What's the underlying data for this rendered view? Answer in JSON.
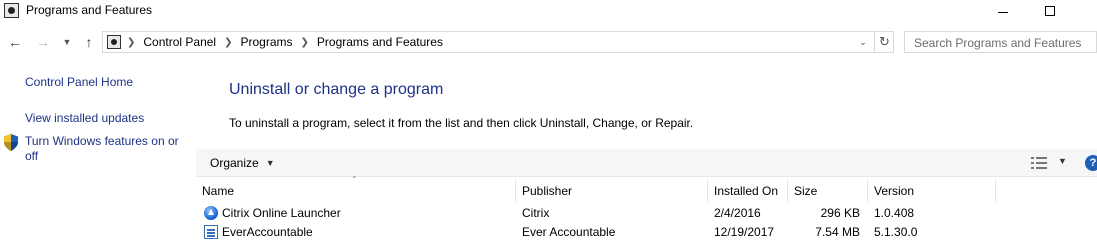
{
  "window": {
    "title": "Programs and Features"
  },
  "address": {
    "crumbs": [
      "Control Panel",
      "Programs",
      "Programs and Features"
    ],
    "search_placeholder": "Search Programs and Features"
  },
  "sidebar": {
    "home": "Control Panel Home",
    "updates": "View installed updates",
    "features": "Turn Windows features on or off"
  },
  "main": {
    "heading": "Uninstall or change a program",
    "description": "To uninstall a program, select it from the list and then click Uninstall, Change, or Repair."
  },
  "toolbar": {
    "organize_label": "Organize"
  },
  "table": {
    "columns": [
      "Name",
      "Publisher",
      "Installed On",
      "Size",
      "Version"
    ],
    "rows": [
      {
        "name": "Citrix Online Launcher",
        "publisher": "Citrix",
        "installed_on": "2/4/2016",
        "size": "296 KB",
        "version": "1.0.408",
        "icon": "citrix-launcher-icon"
      },
      {
        "name": "EverAccountable",
        "publisher": "Ever Accountable",
        "installed_on": "12/19/2017",
        "size": "7.54 MB",
        "version": "5.1.30.0",
        "icon": "app-window-icon"
      }
    ]
  },
  "colors": {
    "link": "#1e3287",
    "toolbar_bg": "#f5f6f7",
    "help_badge": "#1f5fb5"
  }
}
